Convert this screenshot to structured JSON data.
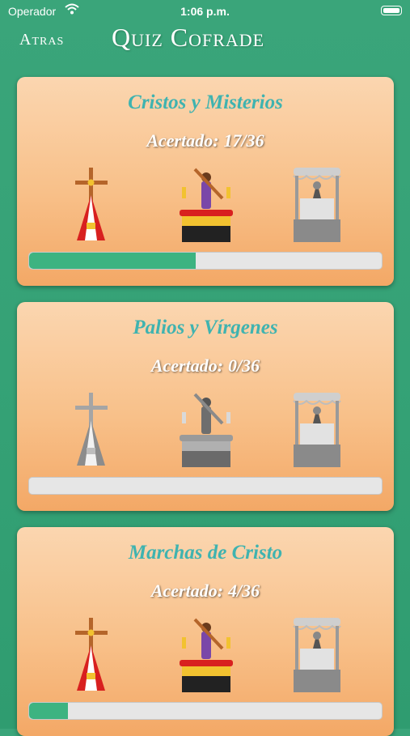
{
  "status_bar": {
    "carrier": "Operador",
    "time": "1:06 p.m."
  },
  "nav": {
    "back_label": "Atras",
    "title": "Quiz Cofrade"
  },
  "colors": {
    "accent_teal": "#3fb3b0",
    "progress_green": "#3db381",
    "background_green": "#35a276"
  },
  "cards": [
    {
      "title": "Cristos y Misterios",
      "score_label": "Acertado:",
      "score": "17/36",
      "progress": 0.472,
      "icons": [
        "nazareno-cross-icon",
        "paso-cristo-icon",
        "palio-icon"
      ],
      "icons_state": [
        "color",
        "color",
        "gray"
      ]
    },
    {
      "title": "Palios y Vírgenes",
      "score_label": "Acertado:",
      "score": "0/36",
      "progress": 0.0,
      "icons": [
        "nazareno-cross-icon",
        "paso-cristo-icon",
        "palio-icon"
      ],
      "icons_state": [
        "gray",
        "gray",
        "gray"
      ]
    },
    {
      "title": "Marchas de Cristo",
      "score_label": "Acertado:",
      "score": "4/36",
      "progress": 0.111,
      "icons": [
        "nazareno-cross-icon",
        "paso-cristo-icon",
        "palio-icon"
      ],
      "icons_state": [
        "color",
        "color",
        "gray"
      ]
    }
  ]
}
